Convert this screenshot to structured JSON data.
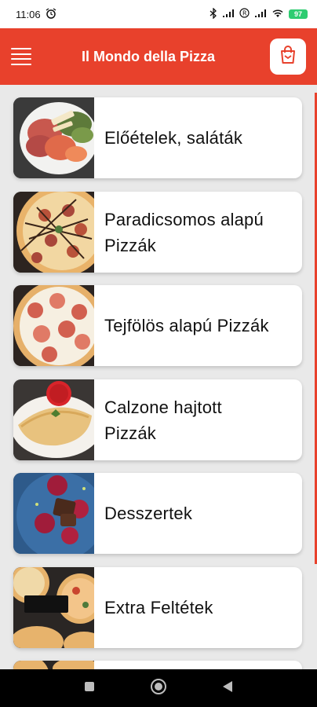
{
  "status_bar": {
    "time": "11:06",
    "battery": "97"
  },
  "app_bar": {
    "title": "Il Mondo della Pizza"
  },
  "colors": {
    "primary": "#e8412c",
    "background": "#e9e9e9",
    "card": "#ffffff"
  },
  "categories": [
    {
      "label": "Előételek, saláták",
      "icon": "antipasto-platter-photo"
    },
    {
      "label": "Paradicsomos alapú Pizzák",
      "icon": "tomato-pizza-photo"
    },
    {
      "label": "Tejfölös alapú Pizzák",
      "icon": "sour-cream-pizza-photo"
    },
    {
      "label": "Calzone hajtott Pizzák",
      "icon": "calzone-photo"
    },
    {
      "label": "Desszertek",
      "icon": "dessert-photo"
    },
    {
      "label": "Extra Feltétek",
      "icon": "extra-toppings-photo"
    }
  ]
}
